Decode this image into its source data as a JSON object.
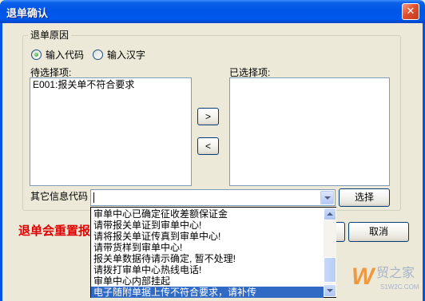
{
  "window": {
    "title": "退单确认"
  },
  "group": {
    "legend": "退单原因"
  },
  "radios": [
    {
      "label": "输入代码",
      "checked": true
    },
    {
      "label": "输入汉字",
      "checked": false
    }
  ],
  "pending": {
    "label": "待选择项:",
    "items": [
      "E001:报关单不符合要求"
    ]
  },
  "selected": {
    "label": "已选择项:",
    "items": []
  },
  "buttons": {
    "add": ">",
    "remove": "<",
    "choose": "选择",
    "cancel": "取消"
  },
  "other_code": {
    "label": "其它信息代码",
    "value": ""
  },
  "warning": {
    "text": "退单会重置报"
  },
  "dropdown": {
    "options": [
      "审单中心已确定征收差额保证金",
      "请带报关单证到审单中心!",
      "请将报关单证传真到审单中心!",
      "请带货样到审单中心!",
      "报关单数据待请示确定, 暂不处理!",
      "请拨打审单中心热线电话!",
      "审单中心内部挂起",
      "电子随附单据上传不符合要求，请补传"
    ],
    "highlighted_index": 7
  },
  "icons": {
    "close": "close-icon",
    "combo_arrow": "chevron-down-icon",
    "scroll_up": "chevron-up-icon",
    "scroll_down": "chevron-down-icon"
  },
  "watermark": {
    "logo_letter": "W",
    "brand": "贸之家",
    "site": "S1W2C.COM"
  },
  "colors": {
    "title_bar": "#0055E5",
    "dialog_bg": "#ECE9D8",
    "selection": "#316AC5",
    "warning": "#E00000"
  }
}
